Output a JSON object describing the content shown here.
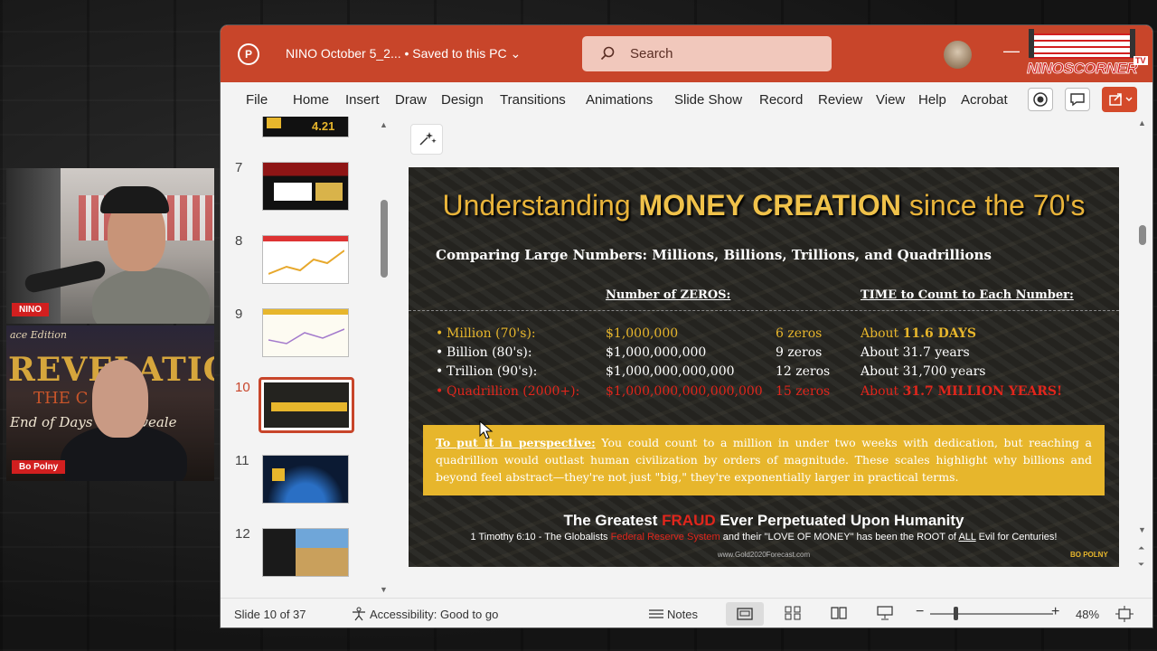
{
  "webcams": [
    {
      "name_label": "NINO"
    },
    {
      "name_label": "Bo Polny",
      "background_top": "ace Edition",
      "background_title": "REVELATION",
      "background_middle": "THE C    NEWS",
      "background_bottom": "End of Days    ine Reveale"
    }
  ],
  "app": {
    "title": "NINO October 5_2... • Saved to this PC ⌄",
    "search_placeholder": "Search",
    "accent": "#c8452a",
    "brand": {
      "name": "NINOSCORNER",
      "tv": "TV"
    }
  },
  "ribbon": {
    "tabs": [
      "File",
      "Home",
      "Insert",
      "Draw",
      "Design",
      "Transitions",
      "Animations",
      "Slide Show",
      "Record",
      "Review",
      "View",
      "Help",
      "Acrobat"
    ]
  },
  "thumbnails": {
    "partial_text": "4.21",
    "items": [
      {
        "number": "7"
      },
      {
        "number": "8"
      },
      {
        "number": "9"
      },
      {
        "number": "10",
        "selected": true
      },
      {
        "number": "11"
      },
      {
        "number": "12"
      }
    ]
  },
  "slide": {
    "title_a": "Understanding ",
    "title_b": "MONEY CREATION",
    "title_c": " since the 70's",
    "subtitle": "Comparing Large Numbers: Millions, Billions, Trillions, and Quadrillions",
    "col_zeros": "Number of ZEROS:",
    "col_time": "TIME to Count to Each Number:",
    "rows": [
      {
        "name": "Million (70's):",
        "value": "$1,000,000",
        "zeros": "6 zeros",
        "time_a": "About ",
        "time_b": "11.6 DAYS",
        "color": "#e7b62c"
      },
      {
        "name": "Billion (80's):",
        "value": "$1,000,000,000",
        "zeros": "9 zeros",
        "time_a": "About 31.7 years",
        "time_b": "",
        "color": "#ffffff"
      },
      {
        "name": "Trillion (90's):",
        "value": "$1,000,000,000,000",
        "zeros": "12 zeros",
        "time_a": "About 31,700 years",
        "time_b": "",
        "color": "#ffffff"
      },
      {
        "name": "Quadrillion (2000+):",
        "value": "$1,000,000,000,000,000",
        "zeros": "15 zeros",
        "time_a": "About ",
        "time_b": "31.7 MILLION YEARS!",
        "color": "#e0261c"
      }
    ],
    "perspective_label": "To put it in perspective:",
    "perspective_text": " You could count to a million in under two weeks with dedication, but reaching a quadrillion would outlast human civilization by orders of magnitude. These scales highlight why billions and beyond feel abstract—they're not just \"big,\" they're exponentially larger in practical terms.",
    "fraud_a": "The Greatest ",
    "fraud_b": "FRAUD",
    "fraud_c": " Ever Perpetuated Upon Humanity",
    "verse_a": "1 Timothy 6:10 - The Globalists ",
    "verse_b": "Federal Reserve System",
    "verse_c": " and their \"LOVE OF MONEY\" has been the ROOT of ",
    "verse_d": "ALL",
    "verse_e": " Evil for Centuries!",
    "site": "www.Gold2020Forecast.com",
    "logo": "BO POLNY"
  },
  "status": {
    "slide_info": "Slide 10 of 37",
    "accessibility": "Accessibility: Good to go",
    "notes": "Notes",
    "zoom": "48%"
  }
}
